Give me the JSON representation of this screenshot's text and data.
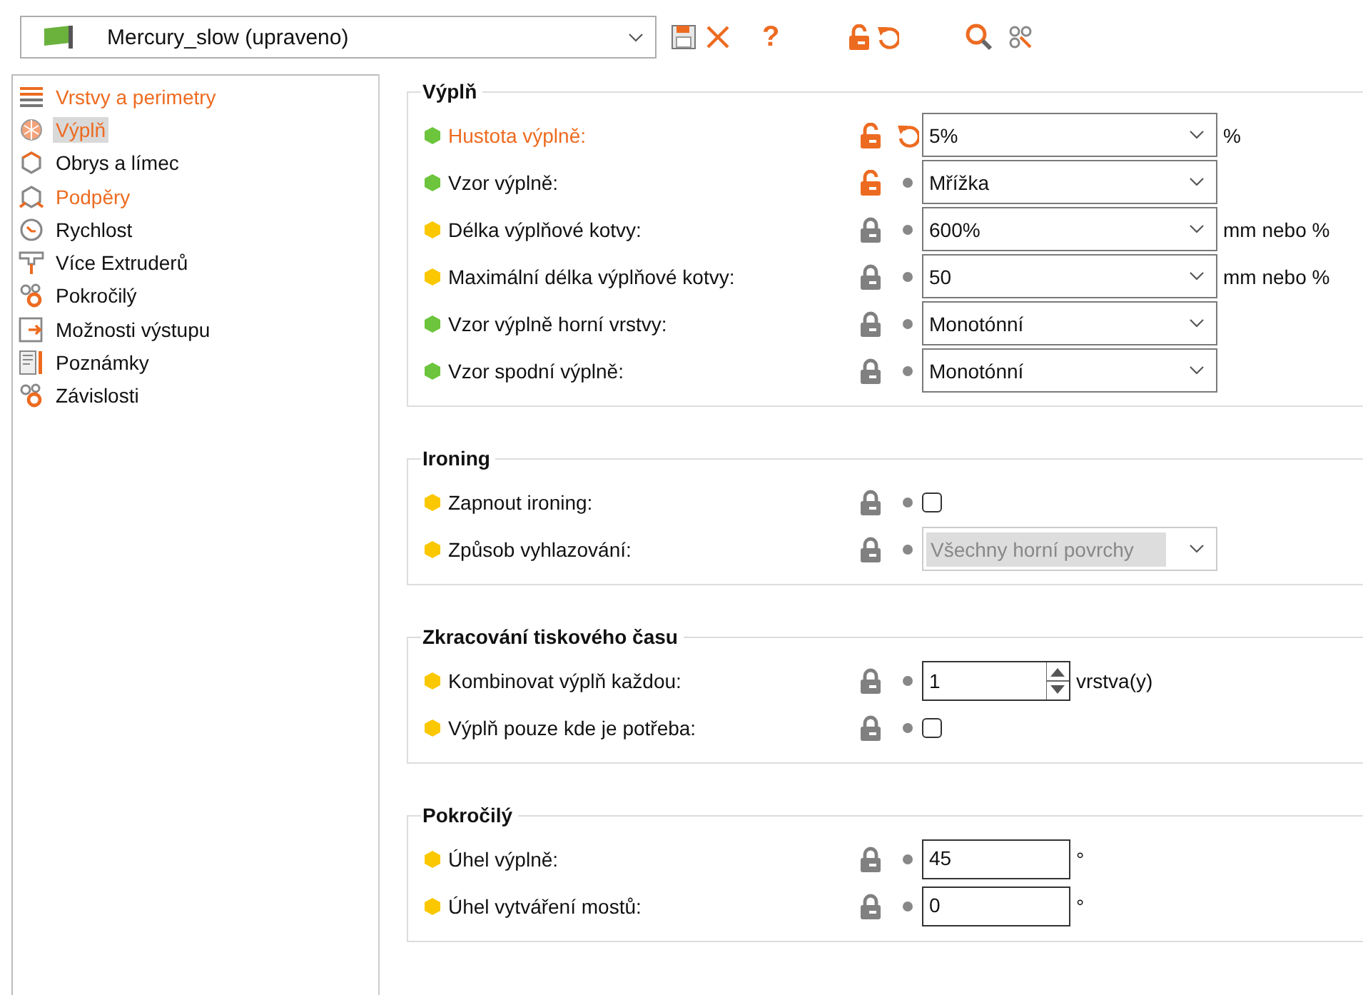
{
  "profile": {
    "value": "Mercury_slow (upraveno)"
  },
  "toolbar": [
    {
      "kind": "save"
    },
    {
      "kind": "close"
    },
    {
      "kind": "help",
      "label": "?"
    },
    {
      "kind": "lock"
    },
    {
      "kind": "undo"
    },
    {
      "kind": "search"
    },
    {
      "kind": "compare"
    }
  ],
  "sidebar": {
    "items": [
      {
        "label": "Vrstvy a perimetry",
        "modified": true,
        "selected": false
      },
      {
        "label": "Výplň",
        "modified": true,
        "selected": true
      },
      {
        "label": "Obrys a límec",
        "modified": false,
        "selected": false
      },
      {
        "label": "Podpěry",
        "modified": true,
        "selected": false
      },
      {
        "label": "Rychlost",
        "modified": false,
        "selected": false
      },
      {
        "label": "Více Extruderů",
        "modified": false,
        "selected": false
      },
      {
        "label": "Pokročilý",
        "modified": false,
        "selected": false
      },
      {
        "label": "Možnosti výstupu",
        "modified": false,
        "selected": false
      },
      {
        "label": "Poznámky",
        "modified": false,
        "selected": false
      },
      {
        "label": "Závislosti",
        "modified": false,
        "selected": false
      }
    ]
  },
  "groups": [
    {
      "title": "Výplň",
      "rows": [
        {
          "label": "Hustota výplně:",
          "color": "#6cc53c",
          "locked": false,
          "modified": true,
          "kind": "combo",
          "value": "5%",
          "unit": "%"
        },
        {
          "label": "Vzor výplně:",
          "color": "#6cc53c",
          "locked": false,
          "modified": false,
          "kind": "combo",
          "value": "Mřížka"
        },
        {
          "label": "Délka výplňové kotvy:",
          "color": "#fbc800",
          "locked": true,
          "modified": false,
          "kind": "combo",
          "value": "600%",
          "unit": "mm nebo %"
        },
        {
          "label": "Maximální délka výplňové kotvy:",
          "color": "#fbc800",
          "locked": true,
          "modified": false,
          "kind": "combo",
          "value": "50",
          "unit": "mm nebo %"
        },
        {
          "label": "Vzor výplně horní vrstvy:",
          "color": "#6cc53c",
          "locked": true,
          "modified": false,
          "kind": "combo",
          "value": "Monotónní"
        },
        {
          "label": "Vzor spodní výplně:",
          "color": "#6cc53c",
          "locked": true,
          "modified": false,
          "kind": "combo",
          "value": "Monotónní"
        }
      ]
    },
    {
      "title": "Ironing",
      "rows": [
        {
          "label": "Zapnout ironing:",
          "color": "#fbc800",
          "locked": true,
          "modified": false,
          "kind": "checkbox",
          "checked": false
        },
        {
          "label": "Způsob vyhlazování:",
          "color": "#fbc800",
          "locked": true,
          "modified": false,
          "kind": "combo",
          "value": "Všechny horní povrchy",
          "disabled": true
        }
      ]
    },
    {
      "title": "Zkracování tiskového času",
      "rows": [
        {
          "label": "Kombinovat výplň každou:",
          "color": "#fbc800",
          "locked": true,
          "modified": false,
          "kind": "spin",
          "value": "1",
          "unit": "vrstva(y)"
        },
        {
          "label": "Výplň pouze kde je potřeba:",
          "color": "#fbc800",
          "locked": true,
          "modified": false,
          "kind": "checkbox",
          "checked": false
        }
      ]
    },
    {
      "title": "Pokročilý",
      "rows": [
        {
          "label": "Úhel výplně:",
          "color": "#fbc800",
          "locked": true,
          "modified": false,
          "kind": "text",
          "value": "45",
          "unit": "°"
        },
        {
          "label": "Úhel vytváření mostů:",
          "color": "#fbc800",
          "locked": true,
          "modified": false,
          "kind": "text",
          "value": "0",
          "unit": "°"
        }
      ]
    }
  ]
}
